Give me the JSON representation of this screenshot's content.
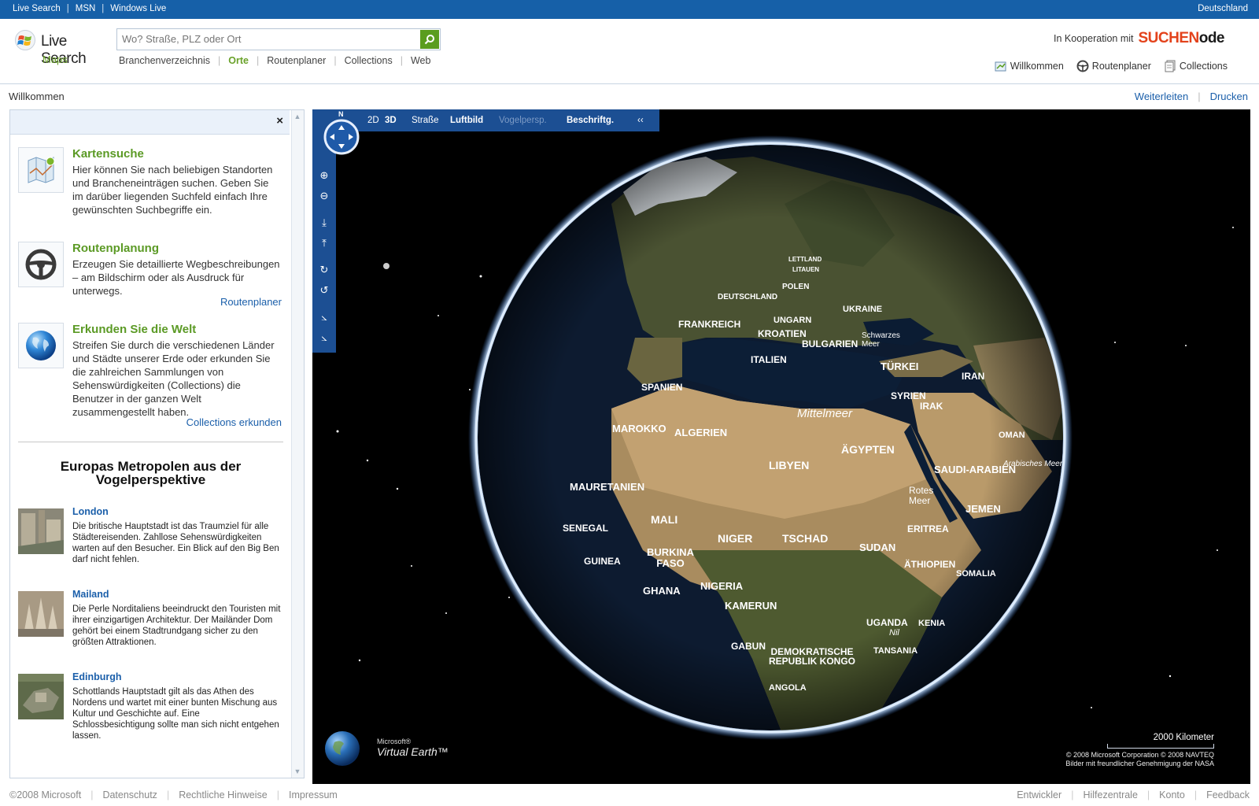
{
  "topbar": {
    "links": [
      "Live Search",
      "MSN",
      "Windows Live"
    ],
    "separator": "|",
    "region": "Deutschland"
  },
  "header": {
    "logo_brand": "Live Search",
    "logo_sub": "Maps",
    "search_placeholder": "Wo? Straße, PLZ oder Ort",
    "nav": [
      "Branchenverzeichnis",
      "Orte",
      "Routenplaner",
      "Collections",
      "Web"
    ],
    "nav_active": "Orte",
    "koop_text": "In Kooperation mit",
    "koop_brand_a": "SUCHEN",
    "koop_brand_b": "ode",
    "tools": [
      "Willkommen",
      "Routenplaner",
      "Collections"
    ]
  },
  "titlebar": {
    "title": "Willkommen",
    "actions": [
      "Weiterleiten",
      "Drucken"
    ]
  },
  "panel": {
    "close": "×",
    "features": [
      {
        "title": "Kartensuche",
        "text": "Hier können Sie nach beliebigen Standorten und Brancheneinträgen suchen. Geben Sie im darüber liegenden Suchfeld einfach Ihre gewünschten Suchbegriffe ein.",
        "link": ""
      },
      {
        "title": "Routenplanung",
        "text": "Erzeugen Sie detaillierte Wegbeschreibungen – am Bildschirm oder als Ausdruck für unterwegs.",
        "link": "Routenplaner"
      },
      {
        "title": "Erkunden Sie die Welt",
        "text": "Streifen Sie durch die verschiedenen Länder und Städte unserer Erde oder erkunden Sie die zahlreichen Sammlungen von Sehenswürdigkeiten (Collections) die Benutzer in der ganzen Welt zusammengestellt haben.",
        "link": "Collections erkunden"
      }
    ],
    "metro_title": "Europas Metropolen aus der Vogelperspektive",
    "cities": [
      {
        "name": "London",
        "desc": "Die britische Hauptstadt ist das Traumziel für alle Städtereisenden. Zahllose Sehenswürdigkeiten warten auf den Besucher. Ein Blick auf den Big Ben darf nicht fehlen."
      },
      {
        "name": "Mailand",
        "desc": "Die Perle Norditaliens beeindruckt den Touristen mit ihrer einzigartigen Architektur. Der Mailänder Dom gehört bei einem Stadtrundgang sicher zu den größten Attraktionen."
      },
      {
        "name": "Edinburgh",
        "desc": "Schottlands Hauptstadt gilt als das Athen des Nordens und wartet mit einer bunten Mischung aus Kultur und Geschichte auf. Eine Schlossbesichtigung sollte man sich nicht entgehen lassen."
      }
    ]
  },
  "map": {
    "compass_n": "N",
    "toolbar": {
      "d2": "2D",
      "d3": "3D",
      "strasse": "Straße",
      "luftbild": "Luftbild",
      "vogel": "Vogelpersp.",
      "beschriftung": "Beschriftg.",
      "collapse": "‹‹"
    },
    "labels": [
      {
        "text": "DEUTSCHLAND"
      },
      {
        "text": "POLEN"
      },
      {
        "text": "LETTLAND"
      },
      {
        "text": "LITAUEN"
      },
      {
        "text": "FRANKREICH"
      },
      {
        "text": "UNGARN"
      },
      {
        "text": "UKRAINE"
      },
      {
        "text": "KROATIEN"
      },
      {
        "text": "BULGARIEN"
      },
      {
        "text": "Schwarzes Meer"
      },
      {
        "text": "ITALIEN"
      },
      {
        "text": "TÜRKEI"
      },
      {
        "text": "SPANIEN"
      },
      {
        "text": "SYRIEN"
      },
      {
        "text": "IRAK"
      },
      {
        "text": "IRAN"
      },
      {
        "text": "Mittelmeer"
      },
      {
        "text": "MAROKKO"
      },
      {
        "text": "ALGERIEN"
      },
      {
        "text": "LIBYEN"
      },
      {
        "text": "ÄGYPTEN"
      },
      {
        "text": "MAURETANIEN"
      },
      {
        "text": "SAUDI-ARABIEN"
      },
      {
        "text": "Rotes Meer"
      },
      {
        "text": "MALI"
      },
      {
        "text": "SENEGAL"
      },
      {
        "text": "NIGER"
      },
      {
        "text": "TSCHAD"
      },
      {
        "text": "JEMEN"
      },
      {
        "text": "SUDAN"
      },
      {
        "text": "ERITREA"
      },
      {
        "text": "BURKINA FASO"
      },
      {
        "text": "GUINEA"
      },
      {
        "text": "GHANA"
      },
      {
        "text": "NIGERIA"
      },
      {
        "text": "ÄTHIOPIEN"
      },
      {
        "text": "SOMALIA"
      },
      {
        "text": "KAMERUN"
      },
      {
        "text": "UGANDA"
      },
      {
        "text": "KENIA"
      },
      {
        "text": "Nil"
      },
      {
        "text": "GABUN"
      },
      {
        "text": "DEMOKRATISCHE REPUBLIK KONGO"
      },
      {
        "text": "TANSANIA"
      },
      {
        "text": "ANGOLA"
      },
      {
        "text": "OMAN"
      },
      {
        "text": "Arabisches Meer"
      }
    ],
    "brand_small": "Microsoft®",
    "brand_big": "Virtual Earth™",
    "scale_text": "2000 Kilometer",
    "copyright_1": "© 2008 Microsoft Corporation  © 2008 NAVTEQ",
    "copyright_2": "Bilder mit freundlicher Genehmigung der NASA"
  },
  "footer": {
    "left": [
      "©2008 Microsoft",
      "Datenschutz",
      "Rechtliche Hinweise",
      "Impressum"
    ],
    "right": [
      "Entwickler",
      "Hilfezentrale",
      "Konto",
      "Feedback"
    ]
  }
}
